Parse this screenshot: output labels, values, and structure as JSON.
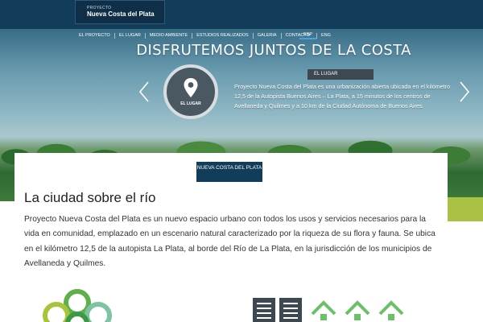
{
  "header": {
    "logo_small": "PROYECTO",
    "logo_big": "Nueva Costa del Plata"
  },
  "nav": {
    "items": [
      {
        "label": "EL PROYECTO"
      },
      {
        "label": "EL LUGAR"
      },
      {
        "label": "MEDIO AMBIENTE"
      },
      {
        "label": "ESTUDIOS REALIZADOS"
      },
      {
        "label": "GALERIA"
      },
      {
        "label": "CONTACTO"
      }
    ],
    "languages": [
      {
        "label": "ESP",
        "active": true
      },
      {
        "label": "ENG",
        "active": false
      }
    ]
  },
  "hero": {
    "title": "DISFRUTEMOS JUNTOS DE LA COSTA",
    "circle_label": "EL LUGAR",
    "tag": "EL LUGAR",
    "description": "Proyecto Nueva Costa del Plata es una urbanización abierta ubicada en el kilómetro 12,5 de la Autopista Buenos Aires – La Plata, a 15 minutos de los centros de Avellaneda y Quilmes y a 10 km de la Ciudad Autónoma de Buenos Aires.",
    "arrow_left_icon": "chevron-left-icon",
    "arrow_right_icon": "chevron-right-icon",
    "pin_icon": "location-pin-icon"
  },
  "content": {
    "badge": "NUEVA COSTA DEL PLATA",
    "title": "La ciudad sobre el río",
    "body": "Proyecto Nueva Costa del Plata es un nuevo espacio urbano con todos los usos y servicios necesarios para la vida en comunidad, emplazado en un escenario natural caracterizado por la riqueza de su flora y fauna. Se ubica en el kilómetro 12,5 de la autopista La Plata, al borde del Río de La Plata, en la jurisdicción de los municipios de Avellaneda y Quilmes."
  },
  "icons": {
    "left": "green-circles-icon",
    "middle": "document-columns-icon",
    "right": "houses-icon"
  },
  "colors": {
    "navy": "#123d5a",
    "green": "#5fb04a",
    "slate": "#3e4850",
    "accent_blue": "#43a6e6"
  }
}
